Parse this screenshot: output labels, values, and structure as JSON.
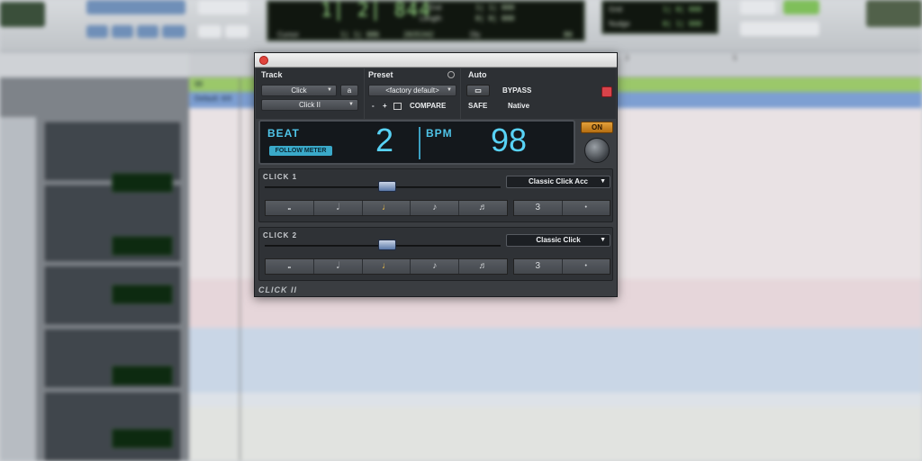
{
  "transport": {
    "main_counter": "1| 2| 844",
    "end_label": "End",
    "end_value": "1| 1| 000",
    "length_label": "Length",
    "length_value": "0| 0| 000",
    "cursor_label": "Cursor",
    "cursor_value": "1| 1| 086",
    "sample_value": "2035342",
    "dly_label": "Dly",
    "level_value": "80"
  },
  "grid": {
    "grid_label": "Grid",
    "grid_value": "1| 0| 000",
    "nudge_label": "Nudge",
    "nudge_value": "0| 1| 000"
  },
  "ruler": {
    "markers": [
      "3",
      "5"
    ]
  },
  "rows": {
    "meter_label": "98",
    "tempo_label": "Default: 4/4"
  },
  "plugin": {
    "track_header": "Track",
    "preset_header": "Preset",
    "auto_header": "Auto",
    "track_select": "Click",
    "track_letter": "a",
    "insert_select": "Click II",
    "preset_select": "<factory default>",
    "preset_minus": "-",
    "preset_plus": "+",
    "compare_label": "COMPARE",
    "bypass_label": "BYPASS",
    "safe_label": "SAFE",
    "native_label": "Native",
    "beat_label": "BEAT",
    "beat_value": "2",
    "follow_meter_label": "FOLLOW METER",
    "bpm_label": "BPM",
    "bpm_value": "98",
    "on_label": "ON",
    "click1": {
      "label": "CLICK 1",
      "sound": "Classic Click Acc",
      "slider_level": 0.52,
      "count": "3"
    },
    "click2": {
      "label": "CLICK 2",
      "sound": "Classic Click",
      "slider_level": 0.52,
      "count": "3"
    },
    "footer_label": "CLICK II"
  },
  "colors": {
    "display_text": "#58d2f5",
    "accent_orange": "#e3a03a",
    "meter_row": "#9bc86a",
    "tempo_row": "#7d9fd2"
  },
  "icons": {
    "note_whole": "𝅝",
    "note_half": "𝅗𝅥",
    "note_quarter": "♩",
    "note_eighth": "♪",
    "note_sixteenth": "♬",
    "dot": "•"
  }
}
